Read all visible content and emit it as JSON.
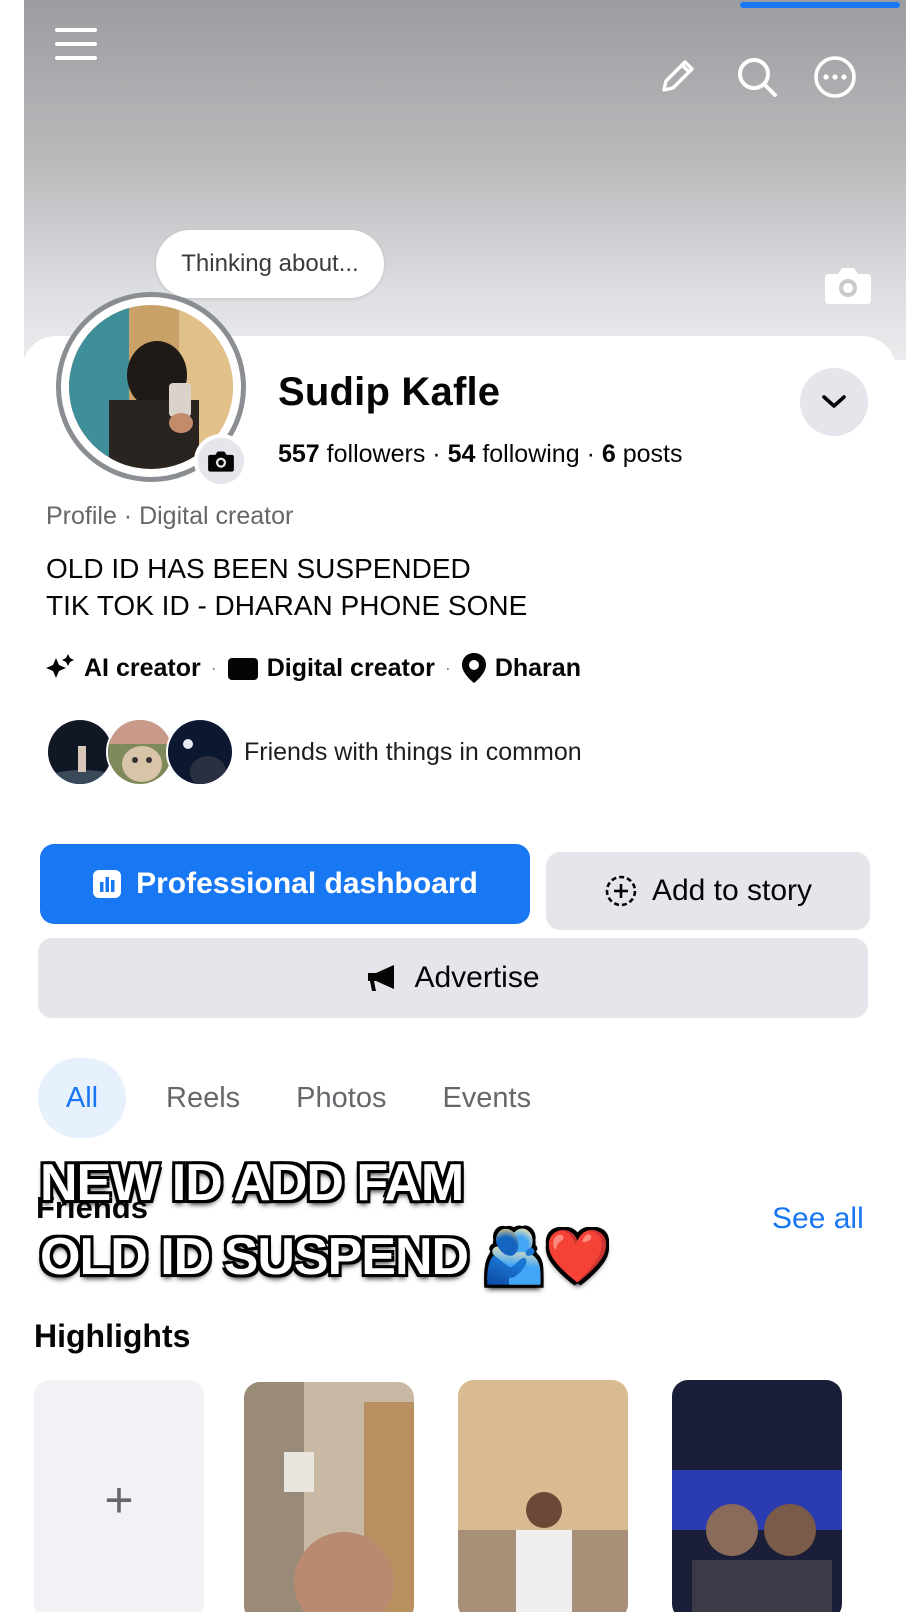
{
  "header": {
    "menu_icon": "hamburger-icon",
    "edit_icon": "pencil-icon",
    "search_icon": "search-icon",
    "more_icon": "more-icon",
    "cover_camera_icon": "camera-icon"
  },
  "profile": {
    "note": "Thinking about...",
    "name": "Sudip Kafle",
    "followers_count": "557",
    "followers_label": "followers",
    "following_count": "54",
    "following_label": "following",
    "posts_count": "6",
    "posts_label": "posts",
    "separator": "·",
    "category": "Profile · Digital creator",
    "bio": "OLD ID HAS BEEN SUSPENDED\nTIK TOK ID - DHARAN PHONE SONE",
    "tags": [
      "AI creator",
      "Digital creator",
      "Dharan"
    ],
    "friends_text": "Friends with things in common"
  },
  "actions": {
    "dashboard": "Professional dashboard",
    "add_story": "Add to story",
    "advertise": "Advertise"
  },
  "tabs": [
    "All",
    "Reels",
    "Photos",
    "Events"
  ],
  "friends": {
    "heading": "Friends",
    "see_all": "See all"
  },
  "overlay": {
    "line1": "NEW ID ADD FAM",
    "line2": "OLD ID SUSPEND 🫂❤️"
  },
  "highlights": {
    "heading": "Highlights",
    "add_symbol": "+"
  },
  "colors": {
    "accent": "#1877f2",
    "button_gray": "#e4e6eb",
    "secondary_text": "#65676b"
  }
}
